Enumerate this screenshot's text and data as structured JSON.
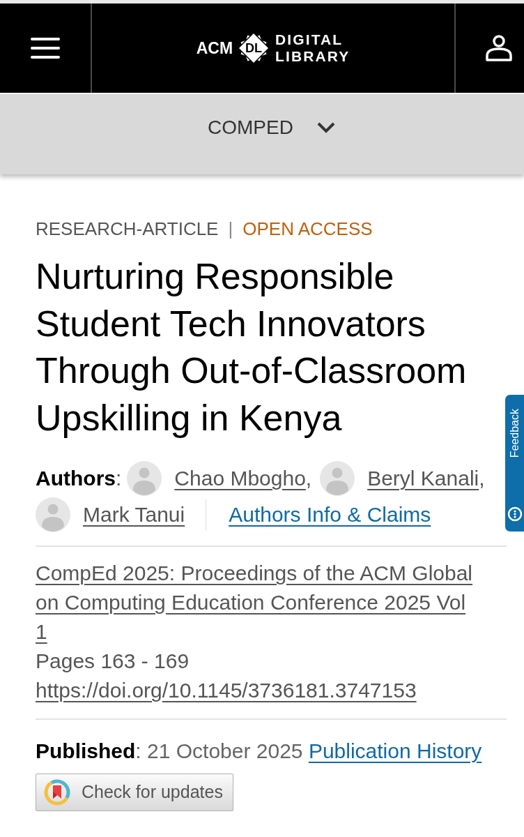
{
  "header": {
    "logo": {
      "acm": "ACM",
      "mark": "DL",
      "line_1": "DIGITAL",
      "line_2": "LIBRARY"
    }
  },
  "journal_bar": {
    "label": "COMPED",
    "expanded": false
  },
  "article": {
    "type": "RESEARCH-ARTICLE",
    "separator": "|",
    "access": "OPEN ACCESS",
    "title": "Nurturing Responsible Student Tech Innovators Through Out-of-Classroom Upskilling in Kenya",
    "authors_label": "**Authors**:",
    "authors": [
      {
        "name": "Chao Mbogho",
        "separator": ","
      },
      {
        "name": "Beryl Kanali",
        "separator": ","
      },
      {
        "name": "Mark Tanui"
      }
    ],
    "authors_info_link": "Authors Info & Claims",
    "proceedings_link": "CompEd 2025: Proceedings of the ACM Global on Computing Education Conference 2025 Vol 1",
    "pages": "Pages 163 - 169",
    "doi_link": "https://doi.org/10.1145/3736181.3747153",
    "published": "**Published**: 21 October 2025",
    "publication_history_link": "Publication History",
    "check_updates_button": "Check for updates"
  },
  "feedback_tab": {
    "label": "Feedback"
  }
}
